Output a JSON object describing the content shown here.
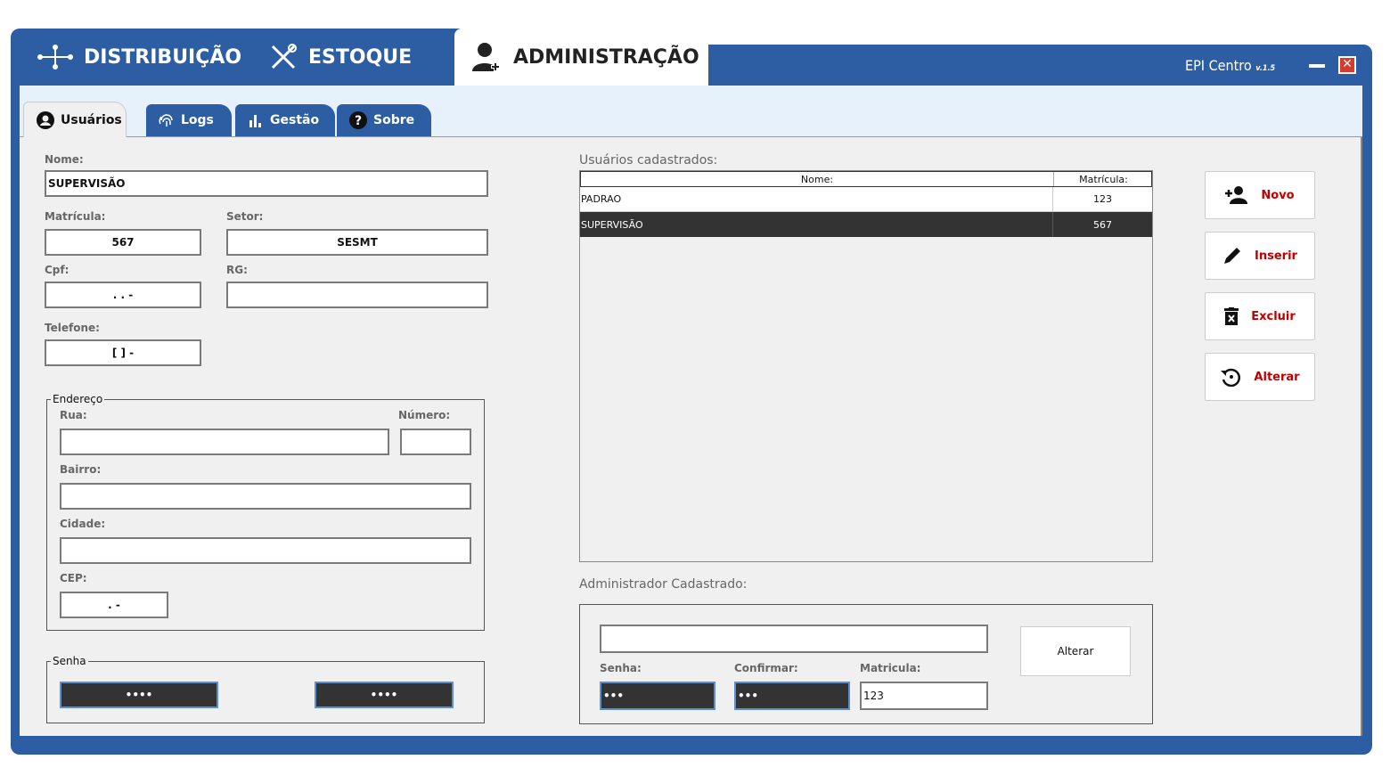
{
  "main_tabs": [
    {
      "label": "DISTRIBUIÇÃO"
    },
    {
      "label": "ESTOQUE"
    },
    {
      "label": "ADMINISTRAÇÃO"
    }
  ],
  "app": {
    "title": "EPI Centro",
    "version": "v.1.5",
    "close_glyph": "✕"
  },
  "sub_tabs": [
    {
      "label": "Usuários",
      "icon": "user-circle-icon"
    },
    {
      "label": "Logs",
      "icon": "fingerprint-icon"
    },
    {
      "label": "Gestão",
      "icon": "bar-chart-icon"
    },
    {
      "label": "Sobre",
      "icon": "question-icon"
    }
  ],
  "form": {
    "nome_label": "Nome:",
    "nome_value": "SUPERVISÃO",
    "matricula_label": "Matrícula:",
    "matricula_value": "567",
    "setor_label": "Setor:",
    "setor_value": "SESMT",
    "cpf_label": "Cpf:",
    "cpf_value": ". . -",
    "rg_label": "RG:",
    "rg_value": "",
    "telefone_label": "Telefone:",
    "telefone_value": "[ ] -"
  },
  "endereco": {
    "title": "Endereço",
    "rua_label": "Rua:",
    "numero_label": "Número:",
    "bairro_label": "Bairro:",
    "cidade_label": "Cidade:",
    "cep_label": "CEP:",
    "cep_value": ". -"
  },
  "senha": {
    "title": "Senha",
    "value1": "••••",
    "value2": "••••"
  },
  "users_list": {
    "label": "Usuários cadastrados:",
    "headers": [
      "Nome:",
      "Matrícula:"
    ],
    "rows": [
      {
        "nome": "PADRAO",
        "matricula": "123",
        "selected": false
      },
      {
        "nome": "SUPERVISÃO",
        "matricula": "567",
        "selected": true
      }
    ]
  },
  "actions": [
    {
      "label": "Novo",
      "icon": "add-user-icon"
    },
    {
      "label": "Inserir",
      "icon": "pencil-icon"
    },
    {
      "label": "Excluir",
      "icon": "trash-icon"
    },
    {
      "label": "Alterar",
      "icon": "history-icon"
    }
  ],
  "admin": {
    "label": "Administrador Cadastrado:",
    "name_value": "",
    "senha_label": "Senha:",
    "senha_value": "•••",
    "confirmar_label": "Confirmar:",
    "confirmar_value": "•••",
    "matricula_label": "Matricula:",
    "matricula_value": "123",
    "alterar_label": "Alterar"
  },
  "colors": {
    "frame_blue": "#2d5ea3",
    "accent_red": "#c00000",
    "selected_row": "#333333"
  }
}
